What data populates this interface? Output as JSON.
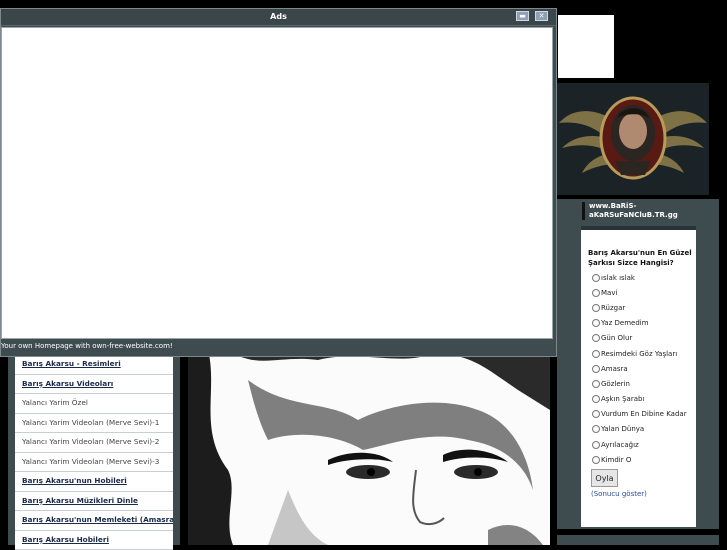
{
  "ads_window": {
    "title": "Ads",
    "footer_text": "Your own Homepage with own-free-website.com!"
  },
  "left_nav": {
    "items": [
      {
        "label": "Barış Akarsu - Resimleri",
        "bold": true
      },
      {
        "label": "Barış Akarsu Videoları",
        "bold": true
      },
      {
        "label": "Yalancı Yarim Özel",
        "bold": false
      },
      {
        "label": "Yalancı Yarim Videoları (Merve Sevi)-1",
        "bold": false
      },
      {
        "label": "Yalancı Yarim Videoları (Merve Sevi)-2",
        "bold": false
      },
      {
        "label": "Yalancı Yarim Videoları (Merve Sevi)-3",
        "bold": false
      },
      {
        "label": "Barış Akarsu'nun Hobileri",
        "bold": true
      },
      {
        "label": "Barış Akarsu Müzikleri Dinle",
        "bold": true
      },
      {
        "label": "Barış Akarsu'nun Memleketi (Amasra)",
        "bold": true
      },
      {
        "label": "Barış Akarsu Hobileri",
        "bold": true
      }
    ]
  },
  "site": {
    "label": "www.BaRiS-aKaRSuFaNCluB.TR.gg"
  },
  "poll": {
    "question": "Barış Akarsu'nun En Güzel Şarkısı Sizce Hangisi?",
    "options": [
      "ıslak ıslak",
      "Mavi",
      "Rüzgar",
      "Yaz Demedim",
      "Gün Olur",
      "Resimdeki Göz Yaşları",
      "Amasra",
      "Gözlerin",
      "Aşkın Şarabı",
      "Vurdum En Dibine Kadar",
      "Yalan Dünya",
      "Ayrılacağız",
      "Kimdir O"
    ],
    "vote_label": "Oyla",
    "results_label": "(Sonucu göster)"
  },
  "colors": {
    "panel": "#3f4c4f",
    "background": "#000000",
    "link": "#1a2a4a"
  }
}
